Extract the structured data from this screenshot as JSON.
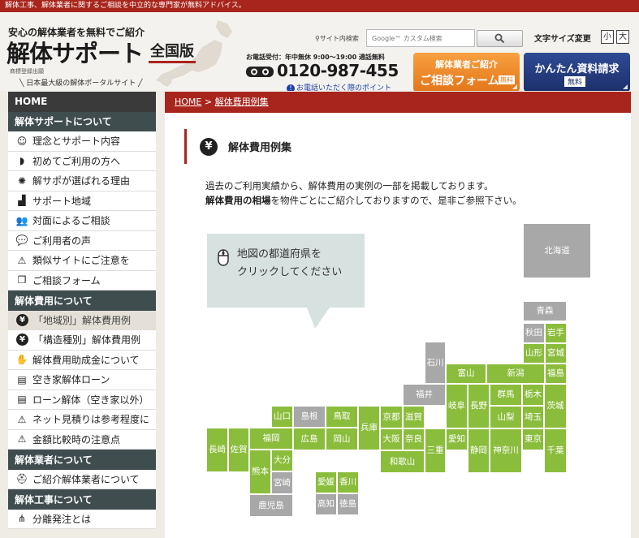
{
  "topbar": {
    "text": "解体工事、解体業者に関するご相談を中立的な専門家が無料アドバイス。"
  },
  "header": {
    "tagline": "安心の解体業者を無料でご紹介",
    "logo": "解体サポート",
    "logo_badge": "全国版",
    "trademark": "商標登録出願",
    "subtag": "日本最大級の解体ポータルサイト",
    "search_label": "サイト内検索",
    "search_placeholder": "Google™ カスタム検索",
    "fontsize_label": "文字サイズ変更",
    "fontsize_small": "小",
    "fontsize_large": "大",
    "phone_label": "お電話受付：年中無休 9:00～19:00 通話無料",
    "phone_number": "0120-987-455",
    "phone_tip": "お電話いただく際のポイント",
    "cta_consult_line1": "解体業者ご紹介",
    "cta_consult_line2": "ご相談フォーム",
    "cta_consult_badge": "無料",
    "cta_docs_line1": "かんたん資料請求",
    "cta_docs_badge": "無料"
  },
  "sidebar": {
    "home": "HOME",
    "sections": [
      {
        "title": "解体サポートについて",
        "items": [
          {
            "label": "理念とサポート内容",
            "icon": "person-badge-icon"
          },
          {
            "label": "初めてご利用の方へ",
            "icon": "beginner-mark-icon"
          },
          {
            "label": "解サポが選ばれる理由",
            "icon": "gear-badge-icon"
          },
          {
            "label": "サポート地域",
            "icon": "stairs-icon"
          },
          {
            "label": "対面によるご相談",
            "icon": "people-icon"
          },
          {
            "label": "ご利用者の声",
            "icon": "speech-bubble-icon"
          },
          {
            "label": "類似サイトにご注意を",
            "icon": "warning-icon"
          },
          {
            "label": "ご相談フォーム",
            "icon": "copy-icon"
          }
        ]
      },
      {
        "title": "解体費用について",
        "items": [
          {
            "label": "「地域別」解体費用例",
            "icon": "yen-icon",
            "active": true
          },
          {
            "label": "「構造種別」解体費用例",
            "icon": "yen-icon"
          },
          {
            "label": "解体費用助成金について",
            "icon": "hand-coin-icon"
          },
          {
            "label": "空き家解体ローン",
            "icon": "id-card-icon"
          },
          {
            "label": "ローン解体（空き家以外）",
            "icon": "id-card-icon"
          },
          {
            "label": "ネット見積りは参考程度に",
            "icon": "warning-icon"
          },
          {
            "label": "金額比較時の注意点",
            "icon": "warning-icon"
          }
        ]
      },
      {
        "title": "解体業者について",
        "items": [
          {
            "label": "ご紹介解体業者について",
            "icon": "helmet-icon"
          }
        ]
      },
      {
        "title": "解体工事について",
        "items": [
          {
            "label": "分離発注とは",
            "icon": "split-icon"
          }
        ]
      }
    ]
  },
  "main": {
    "breadcrumb_home": "HOME",
    "breadcrumb_sep": ">",
    "breadcrumb_current": "解体費用例集",
    "section_title": "解体費用例集",
    "intro_line1": "過去のご利用実績から、解体費用の実例の一部を掲載しております。",
    "intro_line2_bold": "解体費用の相場",
    "intro_line2_rest": "を物件ごとにご紹介しておりますので、是非ご参照下さい。",
    "callout": "地図の都道府県を\nクリックしてください"
  },
  "map": {
    "colors": {
      "active": "#8bbd3c",
      "inactive": "#a8a8a8"
    },
    "prefectures": [
      {
        "name": "北海道",
        "active": false
      },
      {
        "name": "青森",
        "active": false
      },
      {
        "name": "秋田",
        "active": false
      },
      {
        "name": "岩手",
        "active": true
      },
      {
        "name": "山形",
        "active": true
      },
      {
        "name": "宮城",
        "active": true
      },
      {
        "name": "石川",
        "active": false
      },
      {
        "name": "富山",
        "active": true
      },
      {
        "name": "新潟",
        "active": true
      },
      {
        "name": "福島",
        "active": true
      },
      {
        "name": "福井",
        "active": false
      },
      {
        "name": "岐阜",
        "active": true
      },
      {
        "name": "長野",
        "active": true
      },
      {
        "name": "群馬",
        "active": true
      },
      {
        "name": "栃木",
        "active": true
      },
      {
        "name": "茨城",
        "active": true
      },
      {
        "name": "山口",
        "active": true
      },
      {
        "name": "島根",
        "active": false
      },
      {
        "name": "鳥取",
        "active": true
      },
      {
        "name": "兵庫",
        "active": true
      },
      {
        "name": "京都",
        "active": true
      },
      {
        "name": "滋賀",
        "active": true
      },
      {
        "name": "山梨",
        "active": true
      },
      {
        "name": "埼玉",
        "active": true
      },
      {
        "name": "福岡",
        "active": true
      },
      {
        "name": "広島",
        "active": true
      },
      {
        "name": "岡山",
        "active": true
      },
      {
        "name": "大阪",
        "active": true
      },
      {
        "name": "奈良",
        "active": true
      },
      {
        "name": "愛知",
        "active": true
      },
      {
        "name": "静岡",
        "active": true
      },
      {
        "name": "神奈川",
        "active": true
      },
      {
        "name": "東京",
        "active": true
      },
      {
        "name": "千葉",
        "active": true
      },
      {
        "name": "長崎",
        "active": true
      },
      {
        "name": "佐賀",
        "active": true
      },
      {
        "name": "三重",
        "active": true
      },
      {
        "name": "和歌山",
        "active": true
      },
      {
        "name": "熊本",
        "active": true
      },
      {
        "name": "大分",
        "active": true
      },
      {
        "name": "宮崎",
        "active": false
      },
      {
        "name": "愛媛",
        "active": true
      },
      {
        "name": "香川",
        "active": true
      },
      {
        "name": "鹿児島",
        "active": false
      },
      {
        "name": "高知",
        "active": false
      },
      {
        "name": "徳島",
        "active": false
      }
    ]
  }
}
